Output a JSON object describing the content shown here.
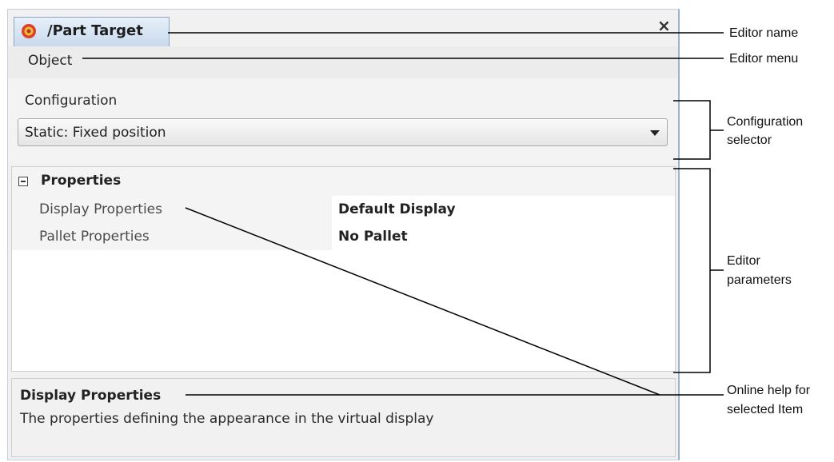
{
  "editor": {
    "tab_title": "/Part Target",
    "close_glyph": "×",
    "tab_icon": "part-target-icon",
    "menu": [
      "Object"
    ],
    "configuration": {
      "label": "Configuration",
      "selected": "Static: Fixed position"
    },
    "properties": {
      "title": "Properties",
      "rows": [
        {
          "name": "Display Properties",
          "value": "Default Display"
        },
        {
          "name": "Pallet Properties",
          "value": "No Pallet"
        }
      ]
    },
    "help": {
      "title": "Display Properties",
      "text": "The properties defining the appearance in the virtual display"
    }
  },
  "callouts": {
    "editor_name": "Editor name",
    "editor_menu": "Editor menu",
    "configuration_selector_line1": "Configuration",
    "configuration_selector_line2": "selector",
    "editor_parameters_line1": "Editor",
    "editor_parameters_line2": "parameters",
    "online_help_line1": "Online help for",
    "online_help_line2": "selected Item"
  },
  "colors": {
    "tab_gradient_top": "#e7f0fb",
    "tab_gradient_bottom": "#c9d9ec",
    "icon_outer": "#d9412b",
    "icon_inner": "#f4b63a"
  }
}
